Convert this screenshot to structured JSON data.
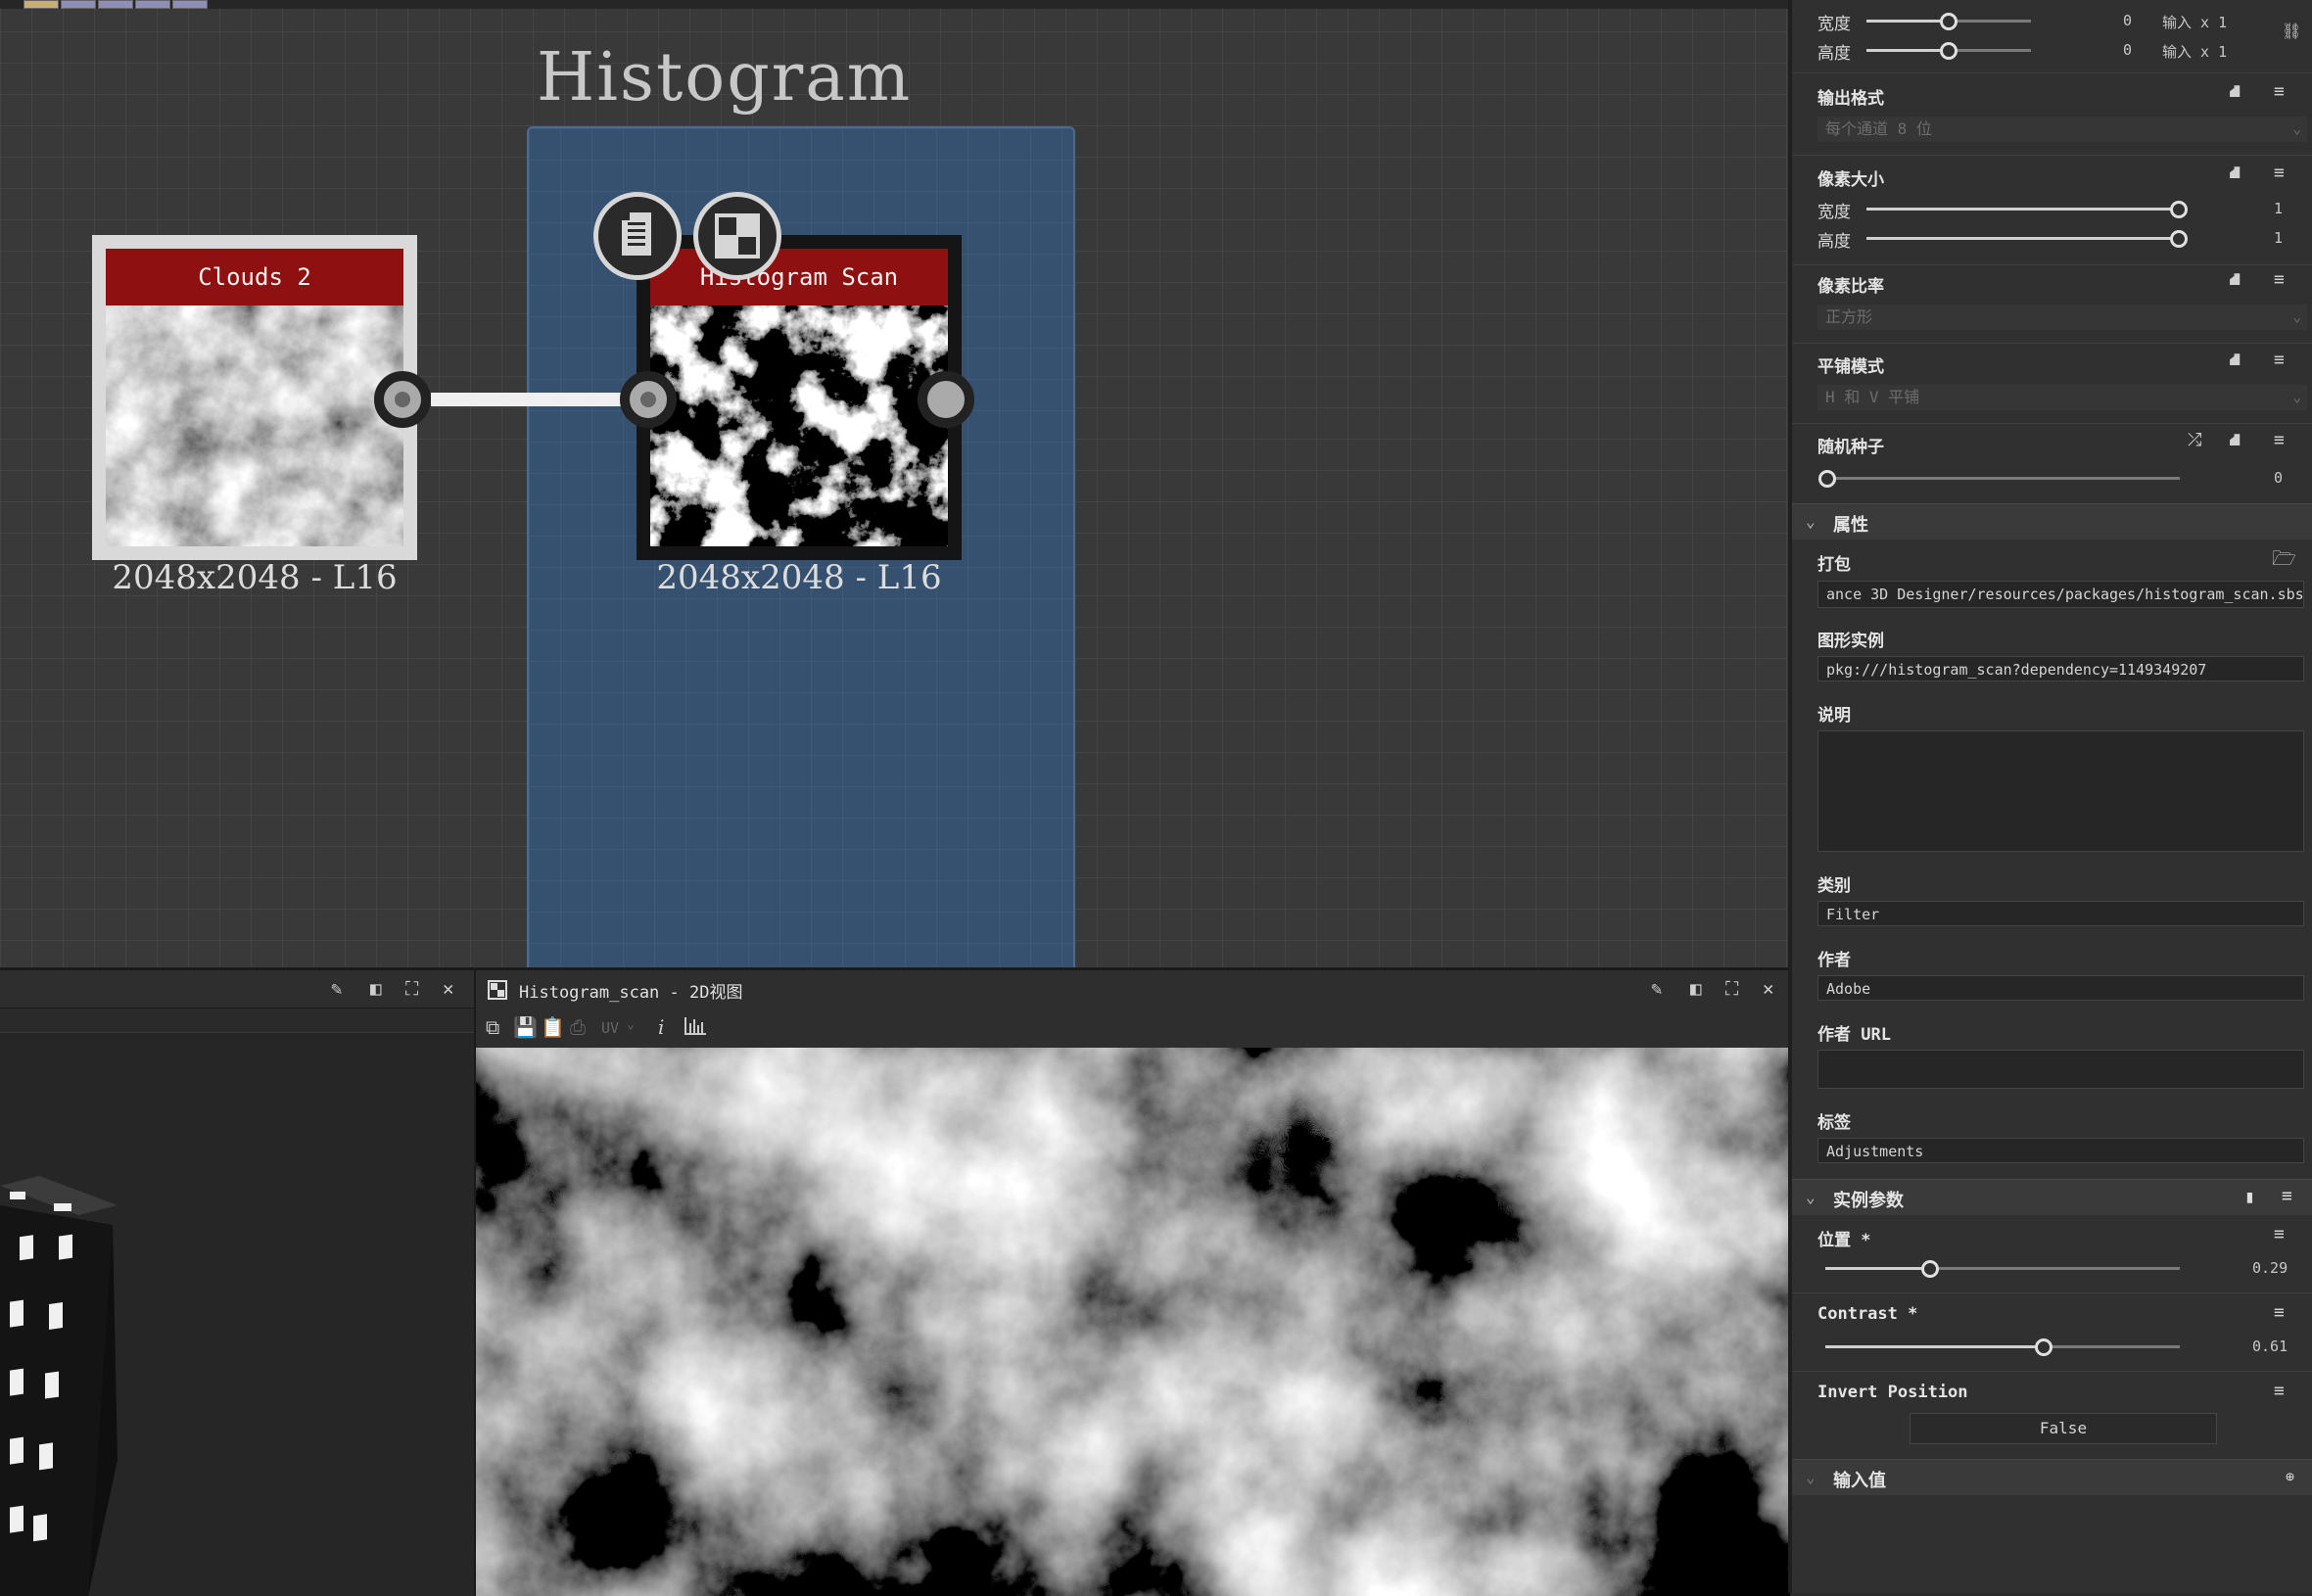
{
  "graph": {
    "frame_title": "Histogram",
    "nodes": [
      {
        "title": "Clouds 2",
        "caption": "2048x2048 - L16"
      },
      {
        "title": "Histogram Scan",
        "caption": "2048x2048 - L16"
      }
    ]
  },
  "view2d": {
    "title": "Histogram_scan - 2D视图",
    "uv_label": "UV"
  },
  "panel": {
    "size_rows": [
      {
        "label": "宽度",
        "value": "0",
        "suffix": "输入 x 1"
      },
      {
        "label": "高度",
        "value": "0",
        "suffix": "输入 x 1"
      }
    ],
    "output_format": {
      "label": "输出格式",
      "value": "每个通道 8 位"
    },
    "pixel_size": {
      "label": "像素大小",
      "rows": [
        {
          "label": "宽度",
          "value": "1"
        },
        {
          "label": "高度",
          "value": "1"
        }
      ]
    },
    "pixel_ratio": {
      "label": "像素比率",
      "value": "正方形"
    },
    "tiling": {
      "label": "平铺模式",
      "value": "H 和 V 平铺"
    },
    "random_seed": {
      "label": "随机种子",
      "value": "0"
    },
    "attributes": {
      "header": "属性",
      "package_label": "打包",
      "package_value": "ance 3D Designer/resources/packages/histogram_scan.sbs",
      "graph_instance_label": "图形实例",
      "graph_instance_value": "pkg:///histogram_scan?dependency=1149349207",
      "description_label": "说明",
      "description_value": "",
      "category_label": "类别",
      "category_value": "Filter",
      "author_label": "作者",
      "author_value": "Adobe",
      "author_url_label": "作者 URL",
      "author_url_value": "",
      "tags_label": "标签",
      "tags_value": "Adjustments"
    },
    "instance_params": {
      "header": "实例参数",
      "position": {
        "label": "位置 *",
        "value": "0.29",
        "level": 0.29
      },
      "contrast": {
        "label": "Contrast *",
        "value": "0.61",
        "level": 0.61
      },
      "invert": {
        "label": "Invert Position",
        "value": "False"
      }
    },
    "inputs": {
      "header": "输入值"
    }
  },
  "colors": {
    "node_header": "#8f1010",
    "frame": "#36506f",
    "panel": "#303030"
  }
}
